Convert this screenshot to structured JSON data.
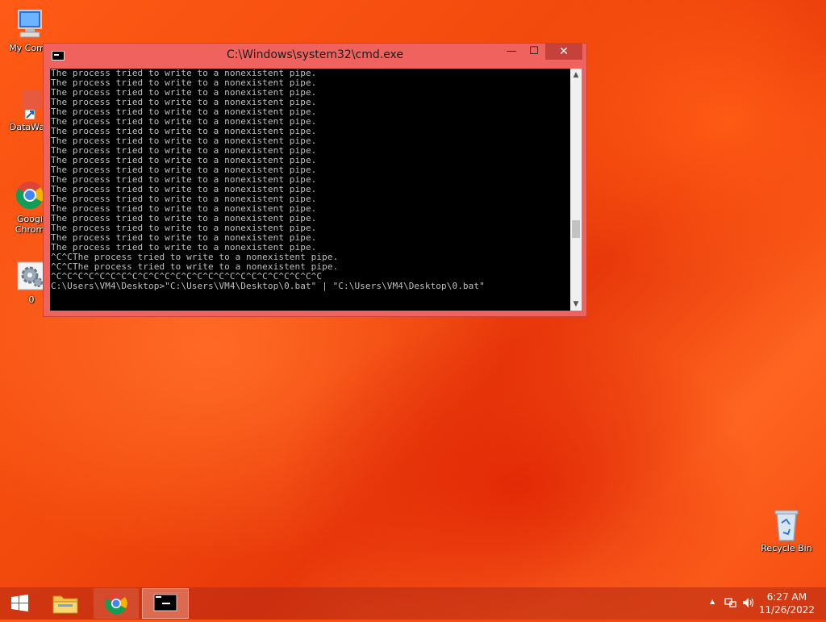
{
  "desktop": {
    "icons": [
      {
        "label": "My Comp"
      },
      {
        "label": "DataWag"
      },
      {
        "label": "Googl Chrom"
      },
      {
        "label": "0"
      },
      {
        "label": "Recycle Bin"
      }
    ]
  },
  "window": {
    "title": "C:\\Windows\\system32\\cmd.exe",
    "minimize": "—",
    "maximize": "☐",
    "close": "✕",
    "console_lines": [
      "The process tried to write to a nonexistent pipe.",
      "The process tried to write to a nonexistent pipe.",
      "The process tried to write to a nonexistent pipe.",
      "The process tried to write to a nonexistent pipe.",
      "The process tried to write to a nonexistent pipe.",
      "The process tried to write to a nonexistent pipe.",
      "The process tried to write to a nonexistent pipe.",
      "The process tried to write to a nonexistent pipe.",
      "The process tried to write to a nonexistent pipe.",
      "The process tried to write to a nonexistent pipe.",
      "The process tried to write to a nonexistent pipe.",
      "The process tried to write to a nonexistent pipe.",
      "The process tried to write to a nonexistent pipe.",
      "The process tried to write to a nonexistent pipe.",
      "The process tried to write to a nonexistent pipe.",
      "The process tried to write to a nonexistent pipe.",
      "The process tried to write to a nonexistent pipe.",
      "The process tried to write to a nonexistent pipe.",
      "The process tried to write to a nonexistent pipe.",
      "^C^CThe process tried to write to a nonexistent pipe.",
      "^C^CThe process tried to write to a nonexistent pipe.",
      "^C^C^C^C^C^C^C^C^C^C^C^C^C^C^C^C^C^C^C^C^C^C^C^C^C",
      "C:\\Users\\VM4\\Desktop>\"C:\\Users\\VM4\\Desktop\\0.bat\" | \"C:\\Users\\VM4\\Desktop\\0.bat\""
    ]
  },
  "taskbar": {
    "tray_up": "▲",
    "time": "6:27 AM",
    "date": "11/26/2022"
  }
}
